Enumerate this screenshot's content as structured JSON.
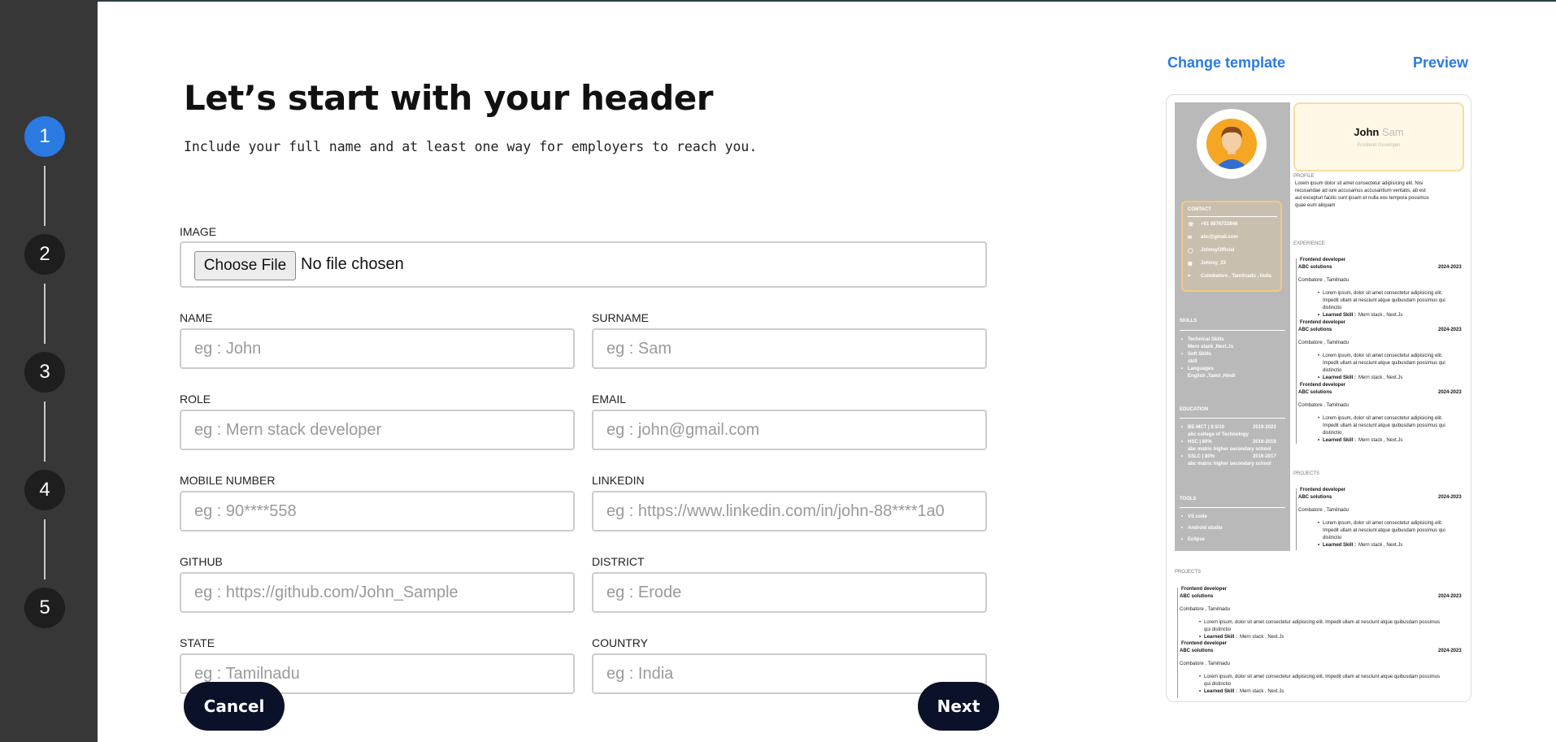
{
  "steps": [
    "1",
    "2",
    "3",
    "4",
    "5"
  ],
  "header": {
    "title": "Let’s start with your header",
    "subtitle": "Include your full name and at least one way for employers to reach you."
  },
  "image": {
    "label": "IMAGE",
    "button": "Choose File",
    "status": "No file chosen"
  },
  "fields": {
    "name": {
      "label": "NAME",
      "placeholder": "eg : John"
    },
    "surname": {
      "label": "SURNAME",
      "placeholder": "eg : Sam"
    },
    "role": {
      "label": "ROLE",
      "placeholder": "eg : Mern stack developer"
    },
    "email": {
      "label": "EMAIL",
      "placeholder": "eg : john@gmail.com"
    },
    "mobile": {
      "label": "MOBILE NUMBER",
      "placeholder": "eg : 90****558"
    },
    "linkedin": {
      "label": "LINKEDIN",
      "placeholder": "eg : https://www.linkedin.com/in/john-88****1a0"
    },
    "github": {
      "label": "GITHUB",
      "placeholder": "eg : https://github.com/John_Sample"
    },
    "district": {
      "label": "DISTRICT",
      "placeholder": "eg : Erode"
    },
    "state": {
      "label": "STATE",
      "placeholder": "eg : Tamilnadu"
    },
    "country": {
      "label": "COUNTRY",
      "placeholder": "eg : India"
    }
  },
  "buttons": {
    "cancel": "Cancel",
    "next": "Next"
  },
  "toplinks": {
    "change_template": "Change template",
    "preview": "Preview"
  },
  "resume": {
    "first_name": "John",
    "last_name": "Sam",
    "role": "Frontend Developer",
    "contact_title": "CONTACT",
    "contacts": [
      "+91 9876732846",
      "abc@gmail.com",
      "JohnsyOfficial",
      "Johnsy_23",
      "Coimbatore , Tamilnadu , India"
    ],
    "skills_title": "SKILLS",
    "skills": [
      "Technical Skills",
      "Mern stack ,Next.Js",
      "Soft Skills",
      "skill",
      "Languages",
      "English ,Tamil ,Hindi"
    ],
    "education_title": "EDUCATION",
    "education": [
      {
        "degree": "BE-MCT | 9.5/10",
        "years": "2019-2023",
        "school": "abc college of Technology"
      },
      {
        "degree": "HSC | 80%",
        "years": "2018-2019",
        "school": "abc matric higher secondary school"
      },
      {
        "degree": "SSLC | 80%",
        "years": "2016-2017",
        "school": "abc matric higher secondary school"
      }
    ],
    "tools_title": "TOOLS",
    "tools": [
      "VS code",
      "Android studio",
      "Eclipse"
    ],
    "profile_title": "PROFILE",
    "profile_text": [
      "Lorem ipsum dolor sit amet consectetur adipisicing elit. Nisi",
      "recusandae ad iure accusamus accusantium veritatis, ab est",
      "aut excepturi facilis sunt ipsam et nulla eos tempora possimus",
      "quae eum aliquam"
    ],
    "experience_title": "EXPERIENCE",
    "projects_title": "PROJECTS",
    "entry": {
      "title": "Frontend developer",
      "company": "ABC solutions",
      "years": "2024-2023",
      "location": "Combatore  ,  Tamilnadu",
      "desc": [
        "Lorem ipsum, dolor sit amet consectetur adipisicing elit.",
        "Impedit ullam at nesciunt atque quibusdam possimus qui",
        "distinctio"
      ],
      "desc_wide": [
        "Lorem ipsum, dolor sit amet consectetur adipisicing elit. Impedit ullam at nesciunt atque quibusdam possimus",
        "qui distinctio"
      ],
      "skill_label": "Learned Skill :",
      "skill_value": "Mern stack ,  Next.Js"
    }
  }
}
